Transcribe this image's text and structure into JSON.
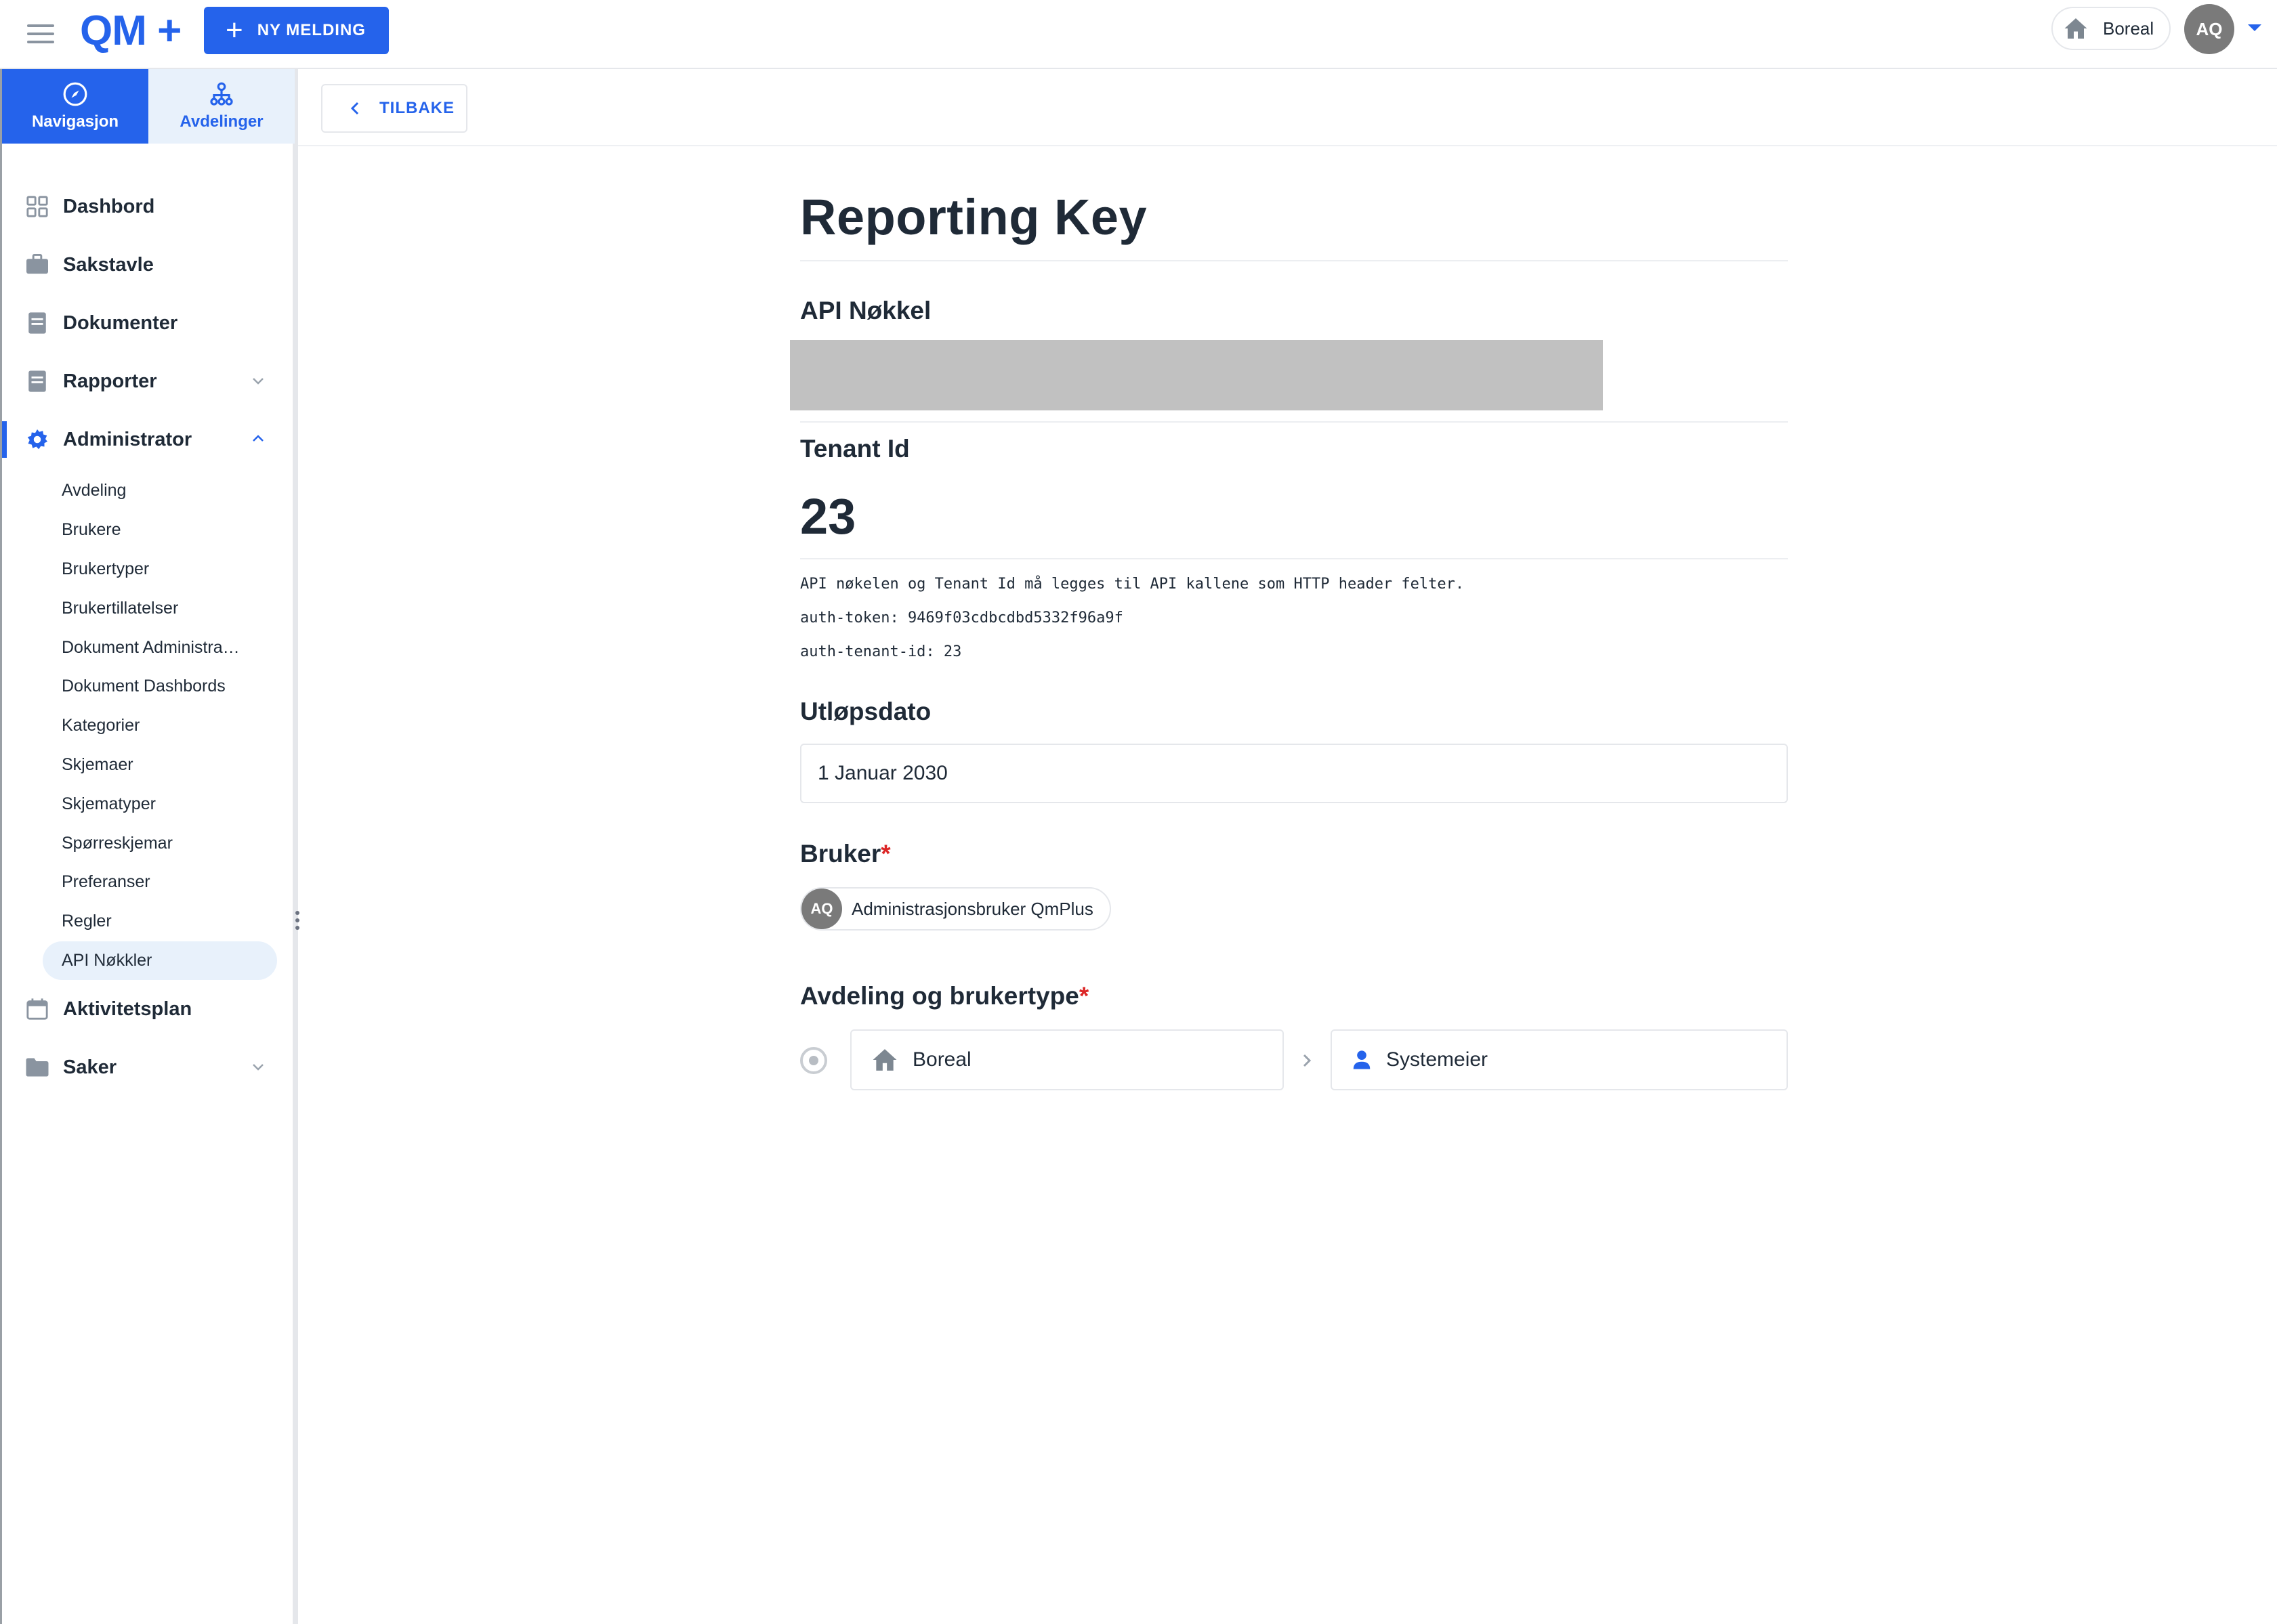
{
  "header": {
    "logo": "QM +",
    "new_button": "NY MELDING",
    "department": "Boreal",
    "avatar_initials": "AQ"
  },
  "sidebar": {
    "tabs": [
      {
        "label": "Navigasjon",
        "icon": "compass-icon"
      },
      {
        "label": "Avdelinger",
        "icon": "org-chart-icon"
      }
    ],
    "items": {
      "dashbord": "Dashbord",
      "sakstavle": "Sakstavle",
      "dokumenter": "Dokumenter",
      "rapporter": "Rapporter",
      "administrator": "Administrator",
      "aktivitetsplan": "Aktivitetsplan",
      "saker": "Saker"
    },
    "admin_sub": [
      "Avdeling",
      "Brukere",
      "Brukertyper",
      "Brukertillatelser",
      "Dokument Administra…",
      "Dokument Dashbords",
      "Kategorier",
      "Skjemaer",
      "Skjematyper",
      "Spørreskjemar",
      "Preferanser",
      "Regler",
      "API Nøkkler"
    ]
  },
  "toolbar": {
    "back_label": "TILBAKE"
  },
  "main": {
    "title": "Reporting Key",
    "api_key_label": "API Nøkkel",
    "tenant_label": "Tenant Id",
    "tenant_value": "23",
    "info_line": "API nøkelen og Tenant Id må legges til API kallene som HTTP header felter.",
    "auth_token_line": "auth-token: 9469f03cdbcdbd5332f96a9f",
    "auth_tenant_line": "auth-tenant-id: 23",
    "expiry_label": "Utløpsdato",
    "expiry_value": "1 Januar 2030",
    "user_label": "Bruker",
    "required_mark": "*",
    "user_initials": "AQ",
    "user_name": "Administrasjonsbruker QmPlus",
    "dept_type_label": "Avdeling og brukertype",
    "dept_value": "Boreal",
    "user_type_value": "Systemeier"
  },
  "colors": {
    "accent": "#2563eb",
    "required": "#dc2626",
    "masked": "#c1c1c1"
  }
}
